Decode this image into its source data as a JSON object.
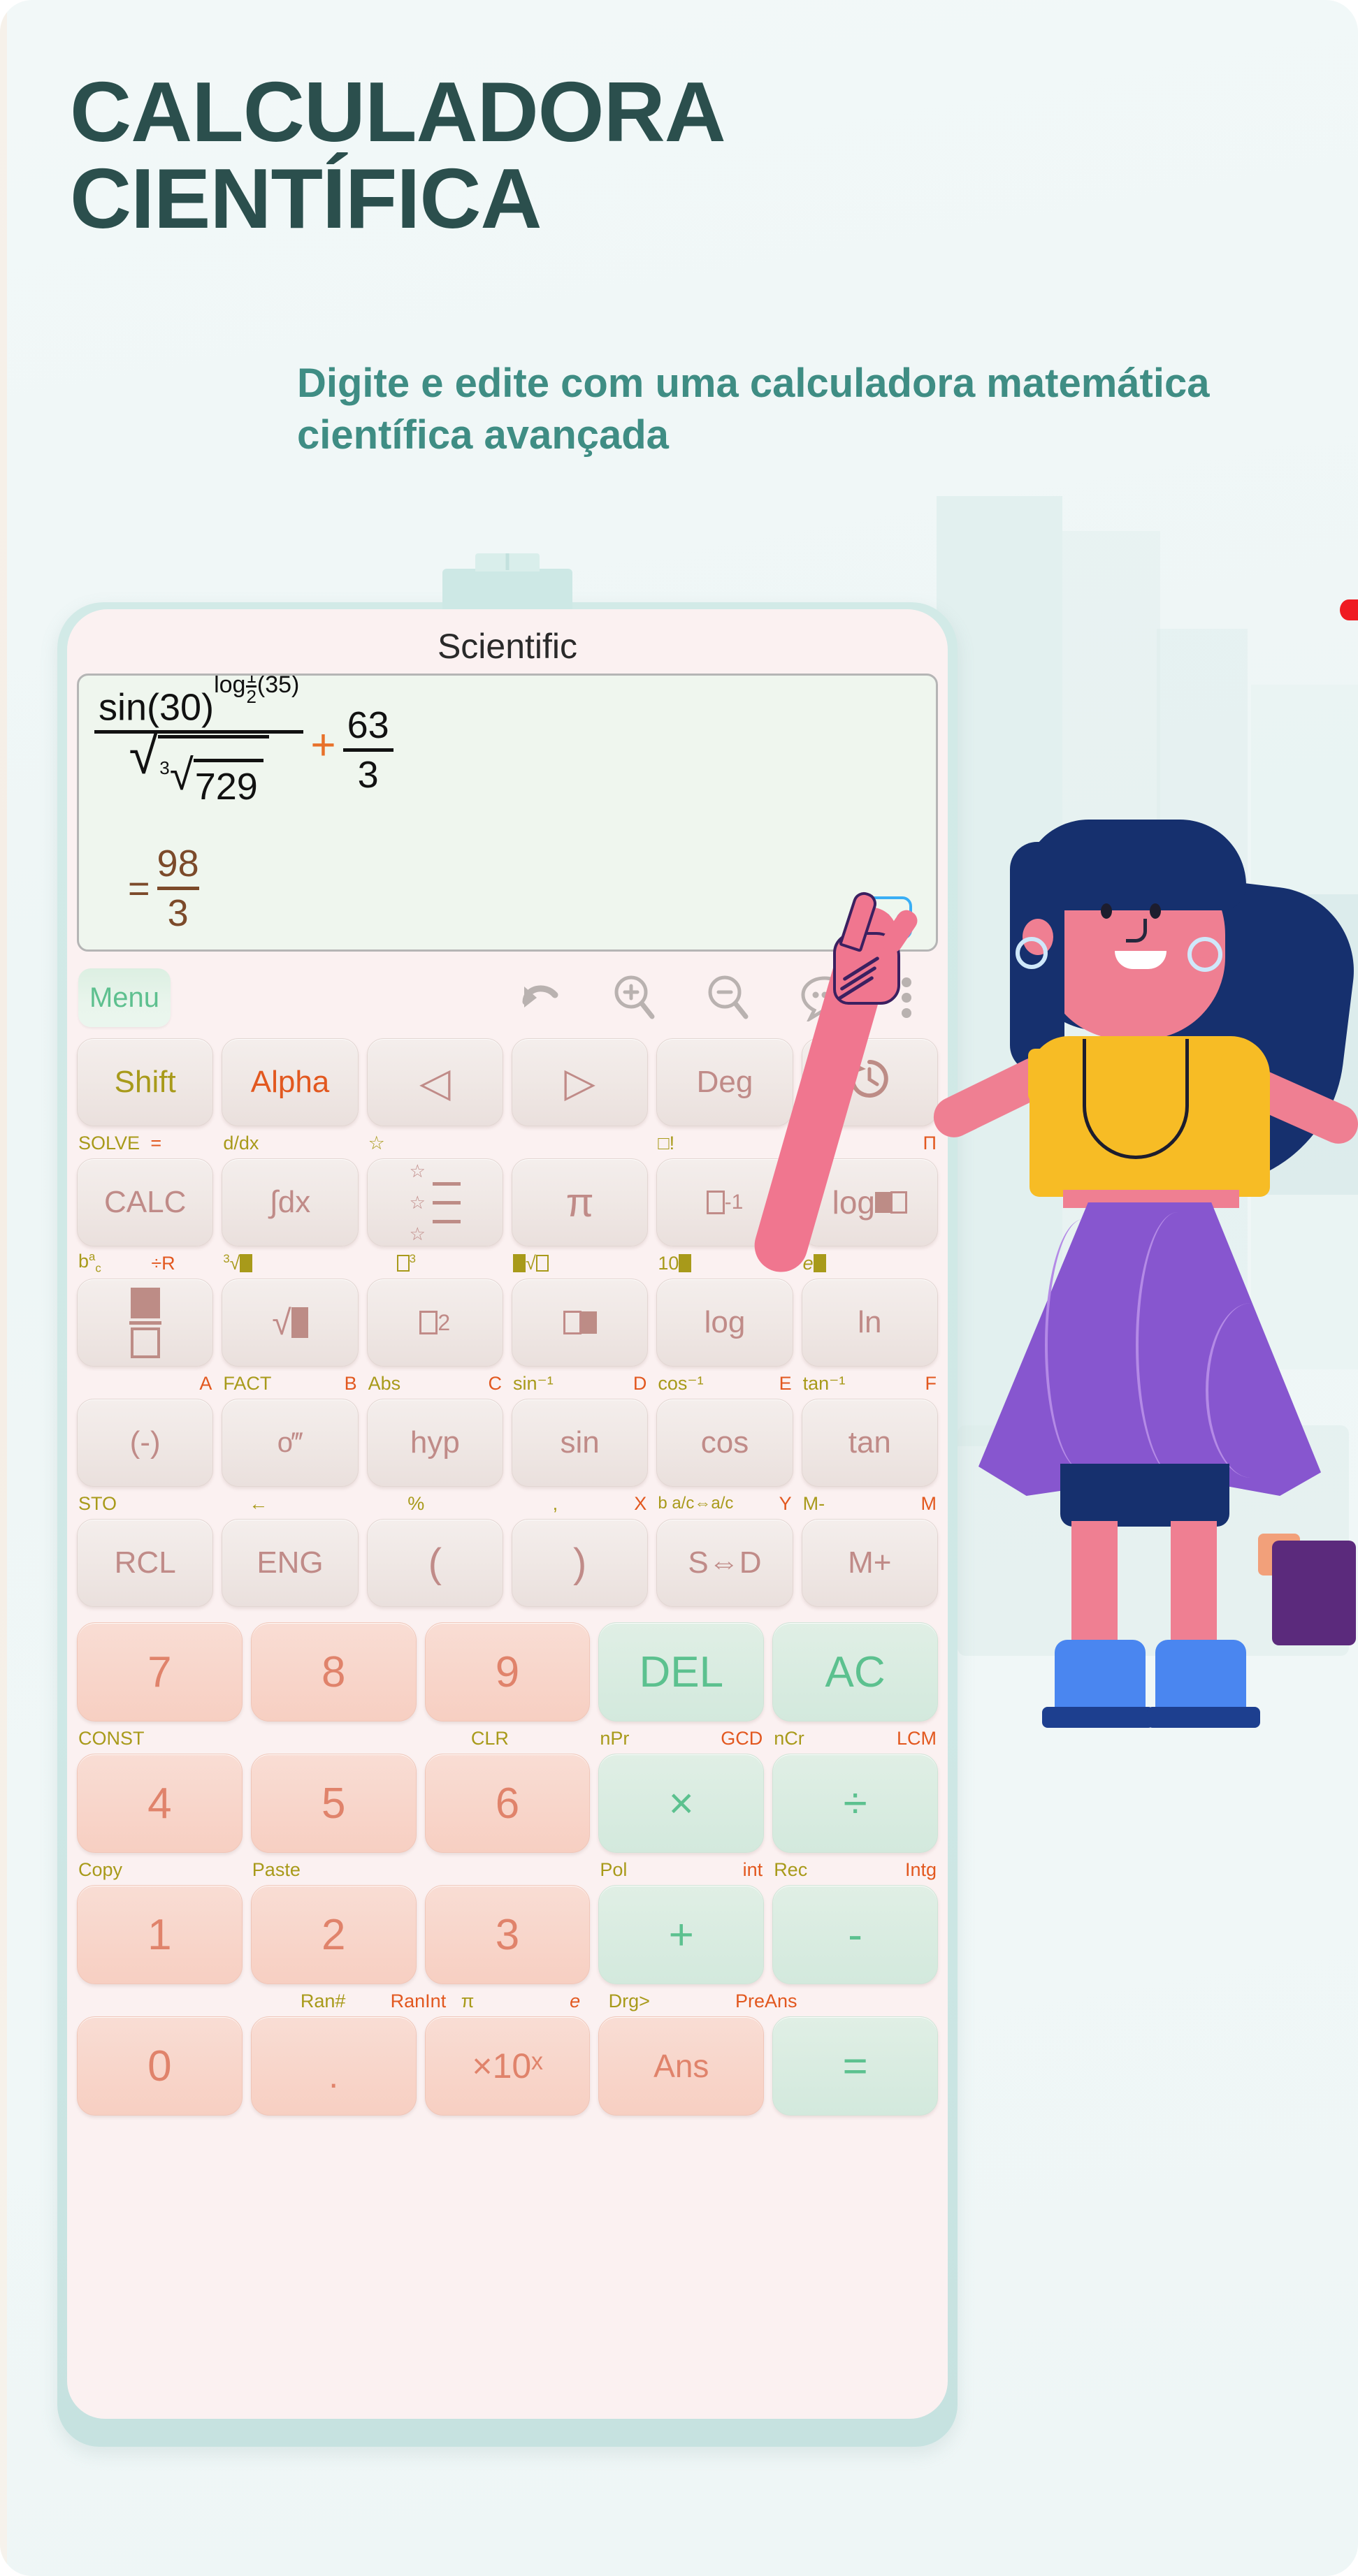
{
  "header": {
    "title_line1": "CALCULADORA",
    "title_line2": "CIENTÍFICA",
    "subtitle": "Digite e edite com uma calculadora matemática científica avançada",
    "title_color": "#2b4f4d",
    "subtitle_color": "#3f8d84"
  },
  "phone": {
    "app_title": "Scientific",
    "frame_color": "#cde8e5",
    "screen_color": "#fbf1f1"
  },
  "display": {
    "expression": {
      "numerator_base": "sin(30)",
      "numerator_exponent_fn": "log",
      "numerator_exponent_sub_num": "1",
      "numerator_exponent_sub_den": "2",
      "numerator_exponent_arg": "(35)",
      "denominator_outer_root": "√",
      "denominator_inner_index": "3",
      "denominator_inner_radicand": "729",
      "operator": "+",
      "operator_color": "#e8712a",
      "second_term_num": "63",
      "second_term_den": "3"
    },
    "result": {
      "equals": "=",
      "numerator": "98",
      "denominator": "3",
      "color": "#7c4a2a"
    },
    "overflow_button": {
      "name": "more-options",
      "dots": "•••",
      "border_color": "#3aaef5",
      "dot_color": "#2a9cf0"
    },
    "bg_color": "#eff6ee"
  },
  "toolbar": {
    "menu_label": "Menu",
    "menu_color": "#5ec08f",
    "icons": [
      {
        "name": "undo-icon",
        "glyph": "undo"
      },
      {
        "name": "zoom-in-icon",
        "glyph": "zoom-in"
      },
      {
        "name": "zoom-out-icon",
        "glyph": "zoom-out"
      },
      {
        "name": "comment-icon",
        "glyph": "speech-bubble"
      },
      {
        "name": "overflow-menu-icon",
        "glyph": "vertical-dots"
      }
    ]
  },
  "keypad": {
    "rows": [
      {
        "keys": [
          {
            "label": "Shift",
            "style": "fn",
            "color": "#a89a1a"
          },
          {
            "label": "Alpha",
            "style": "fn",
            "color": "#e2581f"
          },
          {
            "label": "◁",
            "style": "fn",
            "name": "cursor-left"
          },
          {
            "label": "▷",
            "style": "fn",
            "name": "cursor-right"
          },
          {
            "label": "Deg",
            "style": "fn"
          },
          {
            "label": "history",
            "style": "fn",
            "name": "history-icon"
          }
        ],
        "labels": [
          {
            "left": "SOLVE",
            "right": "=",
            "left_color": "#a89a1a",
            "right_color": "#e2581f"
          },
          {
            "left": "d/dx",
            "left_color": "#a89a1a"
          },
          {
            "left": "☆",
            "left_color": "#a89a1a"
          },
          {},
          {
            "left": "□!",
            "left_color": "#a89a1a"
          },
          {
            "left": "Σ",
            "right": "Π",
            "left_color": "#a89a1a",
            "right_color": "#e2581f"
          }
        ]
      },
      {
        "keys": [
          {
            "label": "CALC",
            "style": "fn"
          },
          {
            "label": "∫dx",
            "style": "fn"
          },
          {
            "label": "star-list",
            "style": "fn",
            "name": "favorites-icon"
          },
          {
            "label": "π",
            "style": "fn"
          },
          {
            "label": "□⁻¹",
            "style": "fn"
          },
          {
            "label": "log□□",
            "style": "fn"
          }
        ],
        "labels": [
          {
            "left": "b a/c",
            "right": "÷R",
            "left_color": "#a89a1a",
            "right_color": "#e2581f"
          },
          {
            "left": "³√■",
            "left_color": "#a89a1a"
          },
          {
            "left": "□³",
            "left_color": "#a89a1a"
          },
          {
            "left": "■√□",
            "left_color": "#a89a1a"
          },
          {
            "left": "10■",
            "left_color": "#a89a1a"
          },
          {
            "left": "e■",
            "left_color": "#a89a1a"
          }
        ]
      },
      {
        "keys": [
          {
            "label": "fraction",
            "style": "fn",
            "name": "fraction-icon"
          },
          {
            "label": "√■",
            "style": "fn"
          },
          {
            "label": "□²",
            "style": "fn"
          },
          {
            "label": "□■",
            "style": "fn"
          },
          {
            "label": "log",
            "style": "fn"
          },
          {
            "label": "ln",
            "style": "fn"
          }
        ],
        "labels": [
          {
            "right": "A",
            "right_color": "#e2581f"
          },
          {
            "left": "FACT",
            "right": "B",
            "left_color": "#a89a1a",
            "right_color": "#e2581f"
          },
          {
            "left": "Abs",
            "right": "C",
            "left_color": "#a89a1a",
            "right_color": "#e2581f"
          },
          {
            "left": "sin⁻¹",
            "right": "D",
            "left_color": "#a89a1a",
            "right_color": "#e2581f"
          },
          {
            "left": "cos⁻¹",
            "right": "E",
            "left_color": "#a89a1a",
            "right_color": "#e2581f"
          },
          {
            "left": "tan⁻¹",
            "right": "F",
            "left_color": "#a89a1a",
            "right_color": "#e2581f"
          }
        ]
      },
      {
        "keys": [
          {
            "label": "(-)",
            "style": "fn"
          },
          {
            "label": "o‴",
            "style": "fn",
            "name": "degree-minute-second"
          },
          {
            "label": "hyp",
            "style": "fn"
          },
          {
            "label": "sin",
            "style": "fn"
          },
          {
            "label": "cos",
            "style": "fn"
          },
          {
            "label": "tan",
            "style": "fn"
          }
        ],
        "labels": [
          {
            "left": "STO",
            "left_color": "#a89a1a"
          },
          {
            "left": "←",
            "left_color": "#a89a1a"
          },
          {
            "left": "%",
            "left_color": "#a89a1a"
          },
          {
            "left": ",",
            "right": "X",
            "left_color": "#a89a1a",
            "right_color": "#e2581f"
          },
          {
            "left": "b a/c⇔a/c",
            "right": "Y",
            "left_color": "#a89a1a",
            "right_color": "#e2581f"
          },
          {
            "left": "M-",
            "right": "M",
            "left_color": "#a89a1a",
            "right_color": "#e2581f"
          }
        ]
      },
      {
        "keys": [
          {
            "label": "RCL",
            "style": "fn"
          },
          {
            "label": "ENG",
            "style": "fn"
          },
          {
            "label": "(",
            "style": "fn"
          },
          {
            "label": ")",
            "style": "fn"
          },
          {
            "label": "S⇔D",
            "style": "fn"
          },
          {
            "label": "M+",
            "style": "fn"
          }
        ],
        "labels": [
          {},
          {},
          {},
          {},
          {},
          {}
        ]
      }
    ],
    "numeric_rows": [
      {
        "keys": [
          {
            "label": "7",
            "style": "num"
          },
          {
            "label": "8",
            "style": "num"
          },
          {
            "label": "9",
            "style": "num"
          },
          {
            "label": "DEL",
            "style": "op"
          },
          {
            "label": "AC",
            "style": "op"
          }
        ],
        "labels": [
          {
            "left": "CONST",
            "left_color": "#a89a1a"
          },
          {},
          {
            "left": "CLR",
            "left_color": "#a89a1a"
          },
          {
            "left": "nPr",
            "right": "GCD",
            "left_color": "#a89a1a",
            "right_color": "#e2581f"
          },
          {
            "left": "nCr",
            "right": "LCM",
            "left_color": "#a89a1a",
            "right_color": "#e2581f"
          }
        ]
      },
      {
        "keys": [
          {
            "label": "4",
            "style": "num"
          },
          {
            "label": "5",
            "style": "num"
          },
          {
            "label": "6",
            "style": "num"
          },
          {
            "label": "×",
            "style": "op"
          },
          {
            "label": "÷",
            "style": "op"
          }
        ],
        "labels": [
          {
            "left": "Copy",
            "left_color": "#a89a1a"
          },
          {
            "left": "Paste",
            "left_color": "#a89a1a"
          },
          {},
          {
            "left": "Pol",
            "right": "int",
            "left_color": "#a89a1a",
            "right_color": "#e2581f"
          },
          {
            "left": "Rec",
            "right": "Intg",
            "left_color": "#a89a1a",
            "right_color": "#e2581f"
          }
        ]
      },
      {
        "keys": [
          {
            "label": "1",
            "style": "num"
          },
          {
            "label": "2",
            "style": "num"
          },
          {
            "label": "3",
            "style": "num"
          },
          {
            "label": "+",
            "style": "op"
          },
          {
            "label": "-",
            "style": "op"
          }
        ],
        "labels": [
          {},
          {
            "left": "Ran#",
            "right": "RanInt",
            "left_color": "#a89a1a",
            "right_color": "#e2581f"
          },
          {
            "left": "π",
            "right": "e",
            "left_color": "#a89a1a",
            "right_color": "#e2581f"
          },
          {
            "left": "Drg>",
            "right": "PreAns",
            "left_color": "#a89a1a",
            "right_color": "#e2581f"
          },
          {}
        ]
      },
      {
        "keys": [
          {
            "label": "0",
            "style": "num"
          },
          {
            "label": ".",
            "style": "num"
          },
          {
            "label": "×10ˣ",
            "style": "num"
          },
          {
            "label": "Ans",
            "style": "num"
          },
          {
            "label": "=",
            "style": "op"
          }
        ],
        "labels": [
          {},
          {},
          {},
          {},
          {}
        ]
      }
    ]
  },
  "illustration": {
    "name": "woman-pointing-at-phone",
    "hair_color": "#16306e",
    "skin_color": "#ef7f92",
    "top_color": "#f7bc25",
    "skirt_color": "#8756cf",
    "boot_color": "#4a86f0"
  },
  "accent_dot_color": "#ef1b22"
}
